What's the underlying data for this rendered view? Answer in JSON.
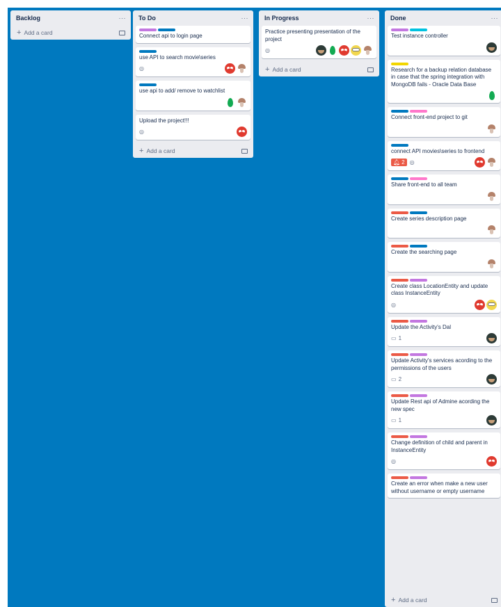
{
  "colors": {
    "board_bg": "#0079bf",
    "list_bg": "#ebecf0",
    "purple": "#c377e0",
    "blue": "#0079bf",
    "teal": "#00c2e0",
    "pink": "#ff78cb",
    "red": "#eb5a46",
    "yellow": "#f2d600",
    "green": "#61bd4f"
  },
  "lists": [
    {
      "title": "Backlog",
      "menu": "···",
      "add_card": "Add a card",
      "cards": []
    },
    {
      "title": "To Do",
      "menu": "···",
      "add_card": "Add a card",
      "cards": [
        {
          "labels": [
            "purple",
            "blue"
          ],
          "title": "Connect api to login page",
          "badges": {},
          "members": []
        },
        {
          "labels": [
            "blue"
          ],
          "title": "use API to search movie\\series",
          "badges": {
            "watch": true
          },
          "members": [
            "red-avatar",
            "mushroom-avatar"
          ]
        },
        {
          "labels": [
            "blue"
          ],
          "title": "use api to add/ remove to watchlist",
          "badges": {},
          "members": [
            "green-avatar",
            "mushroom-avatar"
          ]
        },
        {
          "labels": [],
          "title": "Upload the project!!!",
          "badges": {
            "watch": true
          },
          "members": [
            "red-avatar"
          ]
        }
      ]
    },
    {
      "title": "In Progress",
      "menu": "···",
      "add_card": "Add a card",
      "cards": [
        {
          "labels": [],
          "title": "Practice presenting presentation of the project",
          "badges": {
            "watch": true
          },
          "members": [
            "dark-avatar",
            "green-avatar",
            "red-avatar",
            "yellow-avatar",
            "mushroom-avatar"
          ]
        }
      ]
    },
    {
      "title": "Done",
      "menu": "···",
      "add_card": "Add a card",
      "cards": [
        {
          "labels": [
            "purple",
            "teal"
          ],
          "title": "Test instance controller",
          "badges": {},
          "members": [
            "dark-avatar"
          ]
        },
        {
          "labels": [
            "yellow"
          ],
          "title": "Research for a backup relation database in case that the spring integration with MongoDB fails - Oracle Data Base",
          "badges": {},
          "members": [
            "green-avatar"
          ]
        },
        {
          "labels": [
            "blue",
            "pink"
          ],
          "title": "Connect front-end project to git",
          "badges": {},
          "members": [
            "mushroom-avatar"
          ]
        },
        {
          "labels": [
            "blue"
          ],
          "title": "connect API movies\\series to frontend",
          "badges": {
            "notifications": "2",
            "watch": true
          },
          "members": [
            "red-avatar",
            "mushroom-avatar"
          ]
        },
        {
          "labels": [
            "blue",
            "pink"
          ],
          "title": "Share front-end to all team",
          "badges": {},
          "members": [
            "mushroom-avatar"
          ]
        },
        {
          "labels": [
            "red",
            "blue"
          ],
          "title": "Create series description page",
          "badges": {},
          "members": [
            "mushroom-avatar"
          ]
        },
        {
          "labels": [
            "red",
            "blue"
          ],
          "title": "Create the searching page",
          "badges": {},
          "members": [
            "mushroom-avatar"
          ]
        },
        {
          "labels": [
            "red",
            "purple"
          ],
          "title": "Create class LocationEntity and update class InstanceEntity",
          "badges": {
            "watch": true
          },
          "members": [
            "red-avatar",
            "yellow-avatar"
          ]
        },
        {
          "labels": [
            "red",
            "purple"
          ],
          "title": "Update the Activity's Dal",
          "badges": {
            "comments": "1"
          },
          "members": [
            "dark-avatar"
          ]
        },
        {
          "labels": [
            "red",
            "purple"
          ],
          "title": "Update Activity's services acording to the permissions of the users",
          "badges": {
            "comments": "2"
          },
          "members": [
            "dark-avatar"
          ]
        },
        {
          "labels": [
            "red",
            "purple"
          ],
          "title": "Update Rest api of Admine acording the new spec",
          "badges": {
            "comments": "1"
          },
          "members": [
            "dark-avatar"
          ]
        },
        {
          "labels": [
            "red",
            "purple"
          ],
          "title": "Change definition of child and parent in InstanceEntity",
          "badges": {
            "watch": true
          },
          "members": [
            "red-avatar"
          ]
        },
        {
          "labels": [
            "red",
            "purple"
          ],
          "title": "Create an error when make a new user without username or empty username",
          "badges": {},
          "members": []
        }
      ]
    }
  ]
}
